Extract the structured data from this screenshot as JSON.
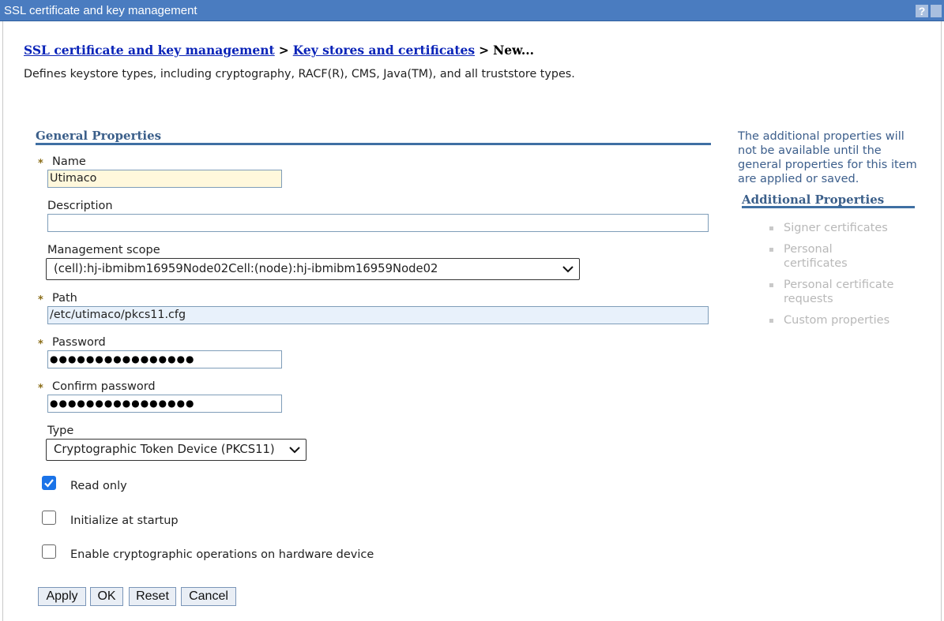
{
  "window": {
    "title": "SSL certificate and key management",
    "help_label": "?"
  },
  "breadcrumb": {
    "link1": "SSL certificate and key management",
    "sep1": ">",
    "link2": "Key stores and certificates",
    "sep2": ">",
    "current": "New..."
  },
  "description": "Defines keystore types, including cryptography, RACF(R), CMS, Java(TM), and all truststore types.",
  "general": {
    "title": "General Properties",
    "required_marker": "*",
    "name_label": "Name",
    "name_value": "Utimaco",
    "description_label": "Description",
    "description_value": "",
    "scope_label": "Management scope",
    "scope_value": "(cell):hj-ibmibm16959Node02Cell:(node):hj-ibmibm16959Node02",
    "path_label": "Path",
    "path_value": "/etc/utimaco/pkcs11.cfg",
    "password_label": "Password",
    "password_mask": "●●●●●●●●●●●●●●●●",
    "confirm_label": "Confirm password",
    "confirm_mask": "●●●●●●●●●●●●●●●●",
    "type_label": "Type",
    "type_value": "Cryptographic Token Device (PKCS11)"
  },
  "checkboxes": [
    {
      "label": "Read only",
      "checked": true
    },
    {
      "label": "Initialize at startup",
      "checked": false
    },
    {
      "label": "Enable cryptographic operations on hardware device",
      "checked": false
    }
  ],
  "buttons": {
    "apply": "Apply",
    "ok": "OK",
    "reset": "Reset",
    "cancel": "Cancel"
  },
  "side": {
    "note": "The additional properties will not be available until the general properties for this item are applied or saved.",
    "title": "Additional Properties",
    "items": [
      "Signer certificates",
      "Personal certificates",
      "Personal certificate requests",
      "Custom properties"
    ]
  },
  "colors": {
    "title_bar": "#4a7cc0",
    "link": "#0b24b8",
    "section": "#3b5f8a",
    "checkbox_on": "#1a73e8",
    "disabled": "#b8b8b8"
  }
}
